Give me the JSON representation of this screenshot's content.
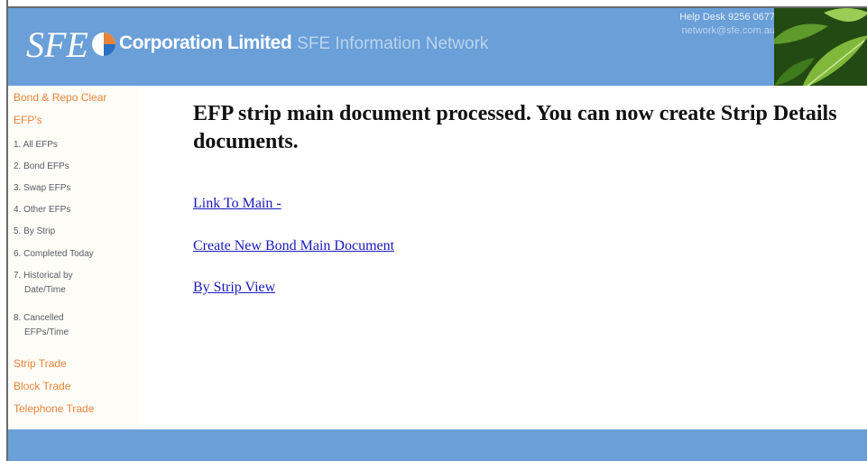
{
  "header": {
    "brand_mark": "SFE",
    "company": "Corporation Limited",
    "network": "SFE Information Network",
    "helpdesk_phone": "Help Desk 9256 0677",
    "helpdesk_email": "network@sfe.com.au",
    "colors": {
      "header_bg": "#6a9fd8",
      "accent_orange": "#e8833a"
    }
  },
  "sidebar": {
    "bond_repo": "Bond & Repo Clear",
    "efps": "EFP's",
    "items": [
      {
        "label": "1. All EFPs"
      },
      {
        "label": "2. Bond EFPs"
      },
      {
        "label": "3. Swap EFPs"
      },
      {
        "label": "4. Other EFPs"
      },
      {
        "label": "5. By Strip"
      },
      {
        "label": "6. Completed Today"
      },
      {
        "label": "7. Historical by",
        "label2": "Date/Time"
      },
      {
        "label": "8. Cancelled",
        "label2": "EFPs/Time"
      }
    ],
    "strip_trade": "Strip Trade",
    "block_trade": "Block Trade",
    "telephone_trade": "Telephone Trade"
  },
  "main": {
    "headline": "EFP strip main document processed. You can now create Strip Details documents.",
    "links": {
      "link_to_main": "Link To Main -",
      "create_new_bond": "Create New Bond Main Document",
      "by_strip_view": "By Strip View"
    }
  }
}
